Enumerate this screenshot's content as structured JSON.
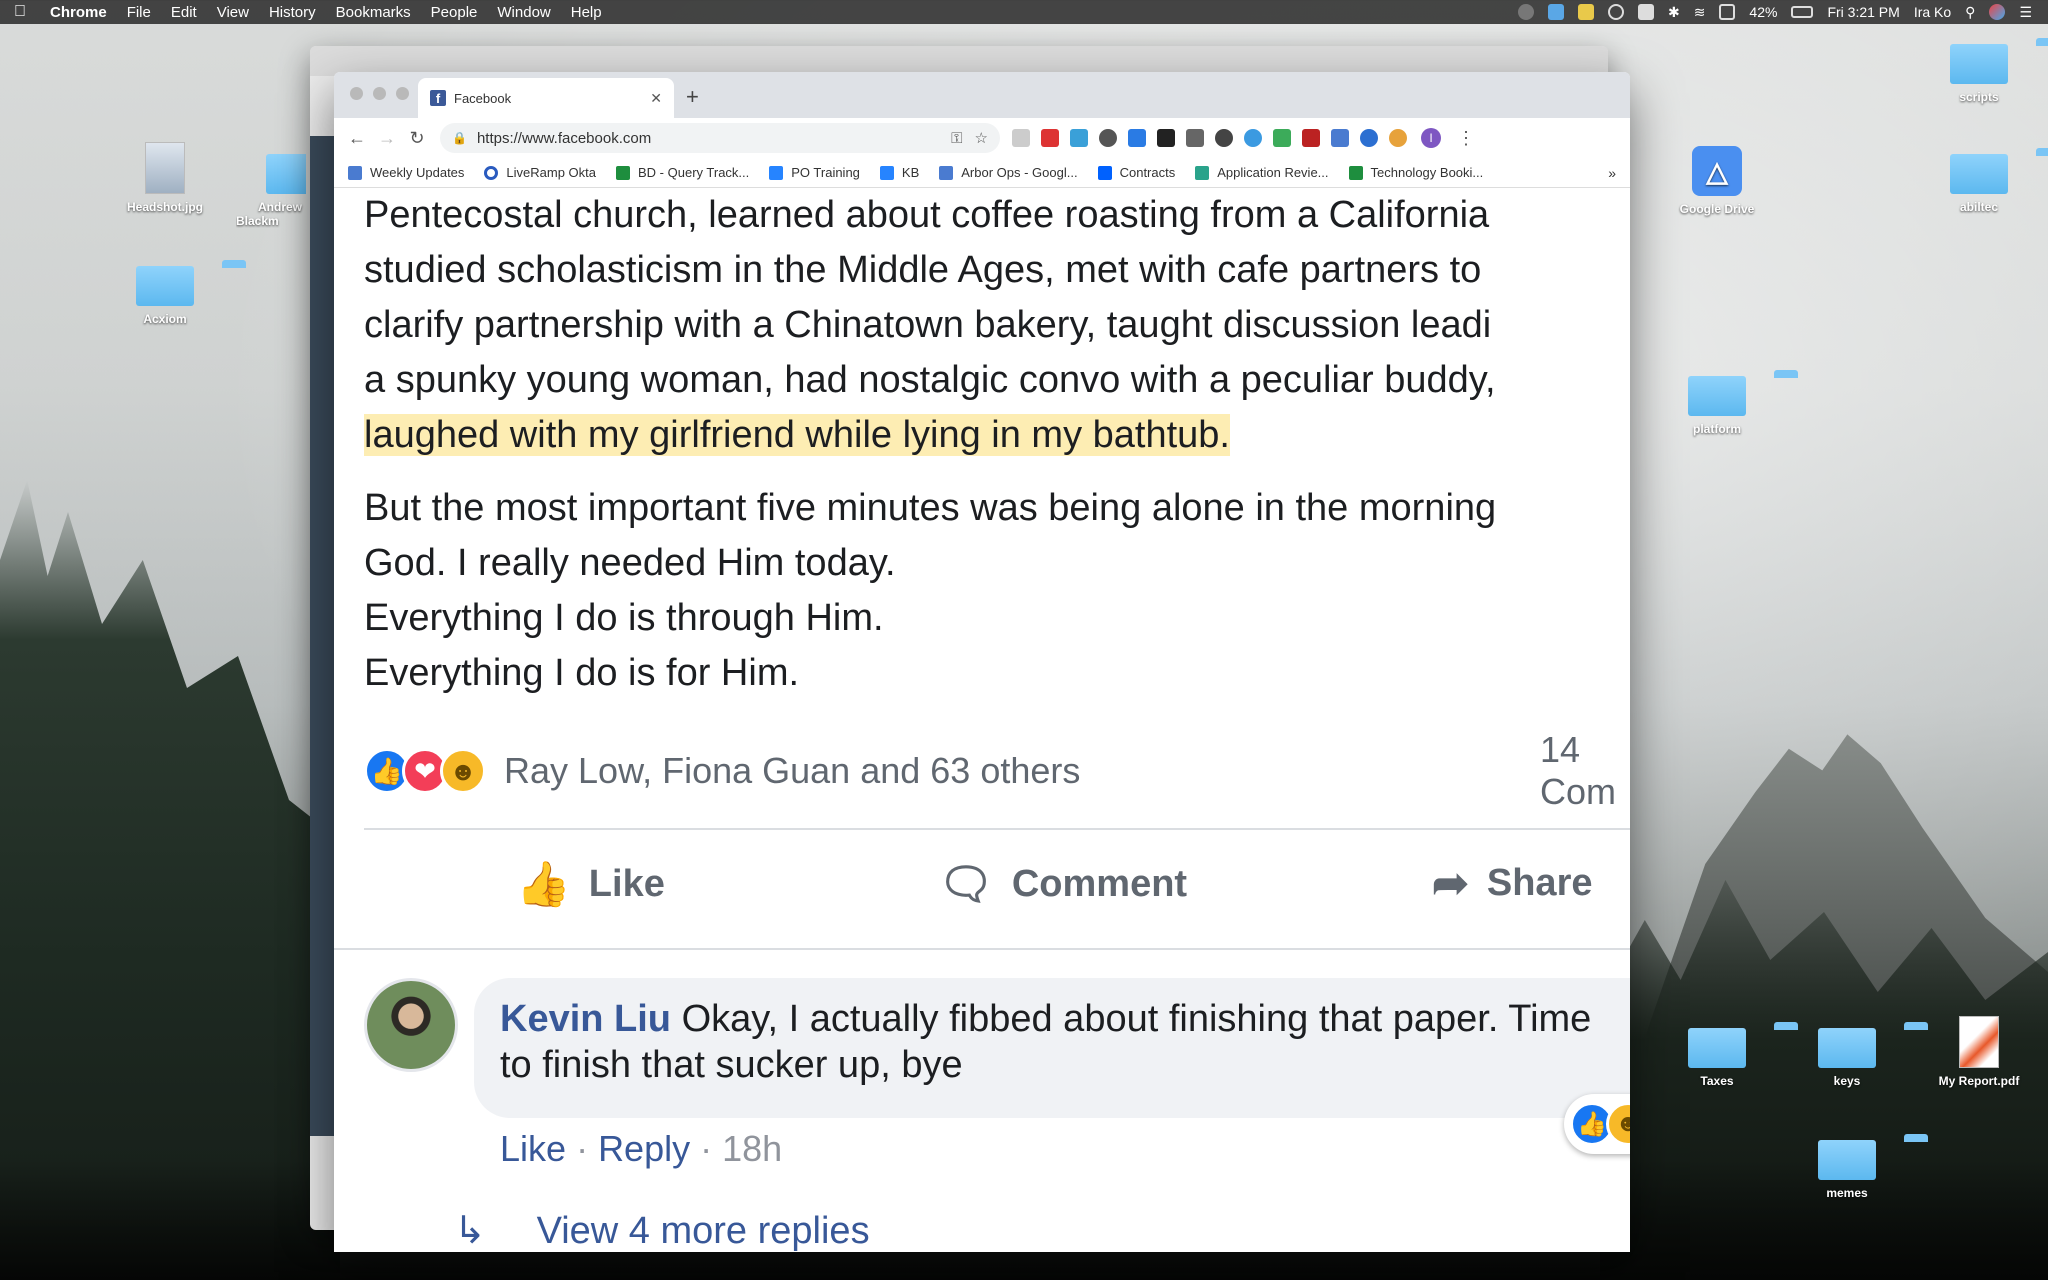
{
  "menubar": {
    "app": "Chrome",
    "items": [
      "File",
      "Edit",
      "View",
      "History",
      "Bookmarks",
      "People",
      "Window",
      "Help"
    ],
    "battery": "42%",
    "clock": "Fri 3:21 PM",
    "user": "Ira Ko"
  },
  "desktop": {
    "icons": [
      "Headshot.jpg",
      "Andrew Blackm",
      "Acxiom",
      "scripts",
      "Google Drive",
      "abiltec",
      "platform",
      "Taxes",
      "keys",
      "My Report.pdf",
      "memes"
    ]
  },
  "browser": {
    "tab_title": "Facebook",
    "url": "https://www.facebook.com",
    "bookmarks": [
      "Weekly Updates",
      "LiveRamp Okta",
      "BD - Query Track...",
      "PO Training",
      "KB",
      "Arbor Ops - Googl...",
      "Contracts",
      "Application Revie...",
      "Technology Booki..."
    ],
    "bookmarks_more": "»",
    "profile_initial": "I"
  },
  "post": {
    "lines1": [
      "Pentecostal church, learned about coffee roasting from a California",
      "studied scholasticism in the Middle Ages, met with cafe partners to",
      "clarify partnership with a Chinatown bakery, taught discussion leadi",
      "a spunky young woman, had nostalgic convo with a peculiar buddy,"
    ],
    "highlight": "laughed with my girlfriend while lying in my bathtub.",
    "lines2": [
      "But the most important five minutes was being alone in the morning",
      "God. I really needed Him today.",
      "Everything I do is through Him.",
      "Everything I do is for Him."
    ],
    "reaction_names": "Ray Low, Fiona Guan and 63 others",
    "comments_count": "14 Com",
    "actions": {
      "like": "Like",
      "comment": "Comment",
      "share": "Share"
    }
  },
  "comment": {
    "author": "Kevin Liu",
    "text_line1": " Okay, I actually fibbed about finishing that paper. Time",
    "text_line2": "to finish that sucker up, bye",
    "like": "Like",
    "reply": "Reply",
    "time": "18h",
    "view_replies": "View 4 more replies"
  },
  "colors": {
    "facebook_blue": "#385898",
    "highlight": "#fdedb3",
    "like": "#1877f2",
    "love": "#f33e58",
    "haha": "#f7b928"
  }
}
